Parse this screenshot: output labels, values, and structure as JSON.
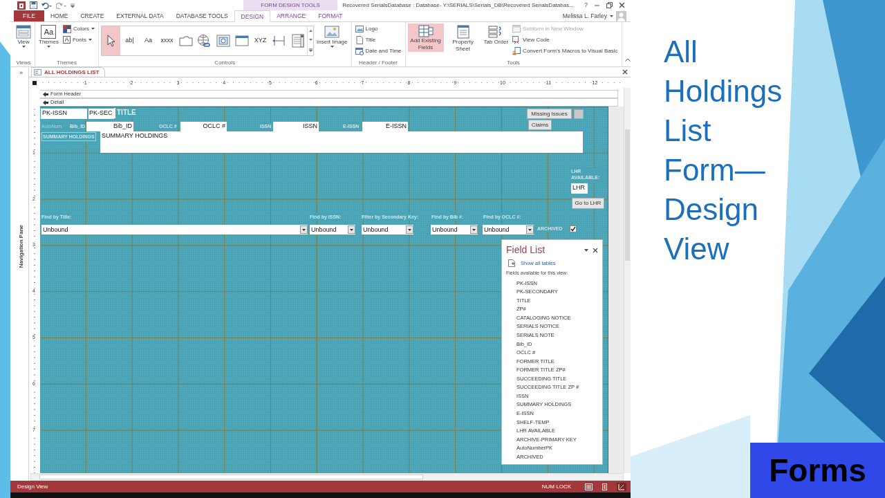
{
  "slide": {
    "title": "All Holdings List Form— Design View",
    "section_label": "Forms"
  },
  "window": {
    "title": "Recovered SerialsDatabase : Database- Y:\\SERIALS\\Serials_DB\\Recovered SerialsDatabas...",
    "context_group": "FORM DESIGN TOOLS",
    "help": "?",
    "user": "Melissa L. Farley"
  },
  "ribbon_tabs": [
    {
      "label": "FILE",
      "kind": "file",
      "selected": false
    },
    {
      "label": "HOME",
      "kind": "tab",
      "selected": false
    },
    {
      "label": "CREATE",
      "kind": "tab",
      "selected": false
    },
    {
      "label": "EXTERNAL DATA",
      "kind": "tab",
      "selected": false
    },
    {
      "label": "DATABASE TOOLS",
      "kind": "tab",
      "selected": false
    },
    {
      "label": "DESIGN",
      "kind": "context",
      "selected": true
    },
    {
      "label": "ARRANGE",
      "kind": "context",
      "selected": false
    },
    {
      "label": "FORMAT",
      "kind": "context",
      "selected": false
    }
  ],
  "ribbon_groups": [
    {
      "label": "Views",
      "items": [
        {
          "kind": "large",
          "label": "View",
          "dropdown": true
        }
      ]
    },
    {
      "label": "Themes",
      "items": [
        {
          "kind": "large",
          "label": "Themes",
          "glyph": "Aa",
          "dropdown": true
        },
        {
          "kind": "small",
          "label": "Colors",
          "dropdown": true
        },
        {
          "kind": "small",
          "label": "Fonts",
          "glyph": "A",
          "dropdown": true
        }
      ]
    },
    {
      "label": "Controls",
      "items": [
        {
          "kind": "gallery",
          "tools": [
            {
              "kind": "pointer",
              "selected": true
            },
            {
              "kind": "textbox",
              "glyph": "ab|",
              "selected": false
            },
            {
              "kind": "label",
              "glyph": "Aa",
              "selected": false
            },
            {
              "kind": "button",
              "glyph": "xxxx",
              "selected": false
            },
            {
              "kind": "tab",
              "selected": false
            },
            {
              "kind": "hyperlink",
              "selected": false
            },
            {
              "kind": "browser",
              "selected": false
            },
            {
              "kind": "navigation",
              "selected": false
            },
            {
              "kind": "option_group",
              "glyph": "XYZ",
              "selected": false
            },
            {
              "kind": "page_break",
              "selected": false
            },
            {
              "kind": "list",
              "selected": false
            }
          ]
        },
        {
          "kind": "large",
          "label": "Insert Image",
          "dropdown": true
        }
      ]
    },
    {
      "label": "Header / Footer",
      "items": [
        {
          "kind": "small",
          "label": "Logo"
        },
        {
          "kind": "small",
          "label": "Title"
        },
        {
          "kind": "small",
          "label": "Date and Time"
        }
      ]
    },
    {
      "label": "Tools",
      "items": [
        {
          "kind": "large",
          "label": "Add Existing Fields",
          "selected": true
        },
        {
          "kind": "large",
          "label": "Property Sheet",
          "selected": false
        },
        {
          "kind": "large",
          "label": "Tab Order",
          "selected": false
        },
        {
          "kind": "small",
          "label": "Subform in New Window",
          "disabled": true
        },
        {
          "kind": "small",
          "label": "View Code",
          "disabled": false
        },
        {
          "kind": "small",
          "label": "Convert Form's Macros to Visual Basic",
          "disabled": false
        }
      ]
    }
  ],
  "navigation_pane": {
    "toggle": "»",
    "label": "Navigation Pane"
  },
  "document_tab": {
    "title": "ALL HOLDINGS LIST"
  },
  "ruler": {
    "horizontal": [
      "1",
      "2",
      "3",
      "4",
      "5",
      "6",
      "7",
      "8",
      "9",
      "10",
      "11",
      "12"
    ],
    "vertical": [
      "1",
      "2",
      "3",
      "4",
      "5",
      "6",
      "7"
    ]
  },
  "sections": [
    "Form Header",
    "Detail"
  ],
  "form_controls": [
    {
      "kind": "textbox",
      "text": "PK-ISSN"
    },
    {
      "kind": "textbox",
      "text": "PK-SEC"
    },
    {
      "kind": "label",
      "text": "TITLE"
    },
    {
      "kind": "label",
      "text": "AutoNum"
    },
    {
      "kind": "label",
      "text": "Bib_ID"
    },
    {
      "kind": "textbox",
      "text": "Bib_ID"
    },
    {
      "kind": "label",
      "text": "OCLC #"
    },
    {
      "kind": "textbox",
      "text": "OCLC #"
    },
    {
      "kind": "label",
      "text": "ISSN"
    },
    {
      "kind": "textbox",
      "text": "ISSN"
    },
    {
      "kind": "label",
      "text": "E-ISSN"
    },
    {
      "kind": "textbox",
      "text": "E-ISSN"
    },
    {
      "kind": "label",
      "text": "SUMMARY HOLDINGS"
    },
    {
      "kind": "textbox",
      "text": "SUMMARY HOLDINGS"
    },
    {
      "kind": "button",
      "text": "Missing Issues"
    },
    {
      "kind": "box"
    },
    {
      "kind": "button",
      "text": "Claims"
    },
    {
      "kind": "label",
      "text": "LHR AVAILABLE:"
    },
    {
      "kind": "textbox",
      "text": "LHR"
    },
    {
      "kind": "button",
      "text": "Go to LHR"
    },
    {
      "kind": "label",
      "text": "Find by Title:"
    },
    {
      "kind": "combo",
      "text": "Unbound"
    },
    {
      "kind": "label",
      "text": "Find by ISSN:"
    },
    {
      "kind": "combo",
      "text": "Unbound"
    },
    {
      "kind": "label",
      "text": "Filter by Secondary Key:"
    },
    {
      "kind": "combo",
      "text": "Unbound"
    },
    {
      "kind": "label",
      "text": "Find by Bib #:"
    },
    {
      "kind": "combo",
      "text": "Unbound"
    },
    {
      "kind": "label",
      "text": "Find by OCLC #:"
    },
    {
      "kind": "combo",
      "text": "Unbound"
    },
    {
      "kind": "label",
      "text": "ARCHIVED"
    },
    {
      "kind": "checkbox",
      "checked": true
    }
  ],
  "field_list": {
    "title": "Field List",
    "show_all": "Show all tables",
    "caption": "Fields available for this view:",
    "fields": [
      "PK-ISSN",
      "PK-SECONDARY",
      "TITLE",
      "ZP#",
      "CATALOGING NOTICE",
      "SERIALS NOTICE",
      "SERIALS NOTE",
      "Bib_ID",
      "OCLC #",
      "FORMER TITLE",
      "FORMER TITLE ZP#",
      "SUCCEEDING TITLE",
      "SUCCEEDING TITLE ZP #",
      "ISSN",
      "SUMMARY HOLDINGS",
      "E-ISSN",
      "SHELF-TEMP",
      "LHR AVAILABLE",
      "ARCHIVE-PRIMARY KEY",
      "AutoNumberPK",
      "ARCHIVED"
    ]
  },
  "status_bar": {
    "mode": "Design View",
    "indicator": "NUM LOCK"
  }
}
